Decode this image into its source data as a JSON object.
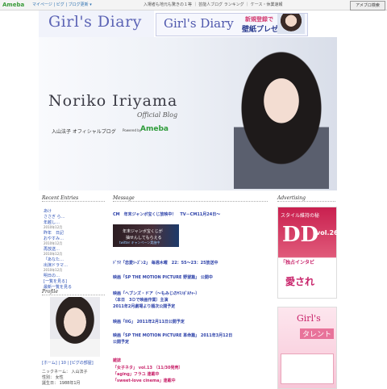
{
  "topbar": {
    "logo": "Ameba",
    "links": "マイページ | ピグ | ブログ更新 ▾",
    "news": "入場者も地元も驚きの１等 ｜ 芸能人ブログ ランキング ｜ ケース・休業速報",
    "search_button": "アメブロ検索"
  },
  "header": {
    "title": "Girl's Diary",
    "banner_title": "Girl's Diary",
    "banner_line1": "新規登録で",
    "banner_line2": "壁紙プレゼント!"
  },
  "hero": {
    "name": "Noriko Iriyama",
    "sub": "Official Blog",
    "jp": "入山法子 オフィシャルブログ",
    "powered": "Powered by",
    "ameba": "Ameba"
  },
  "sidebar": {
    "recent_head": "Recent Entries",
    "entries": [
      {
        "title": "あけ",
        "date": ""
      },
      {
        "title": "ささぎ ら…",
        "date": ""
      },
      {
        "title": "年越し…",
        "date": ""
      },
      {
        "title": "",
        "date": "2010年12月"
      },
      {
        "title": "昨年　日記",
        "date": ""
      },
      {
        "title": "おやすみ…",
        "date": "2010年12月"
      },
      {
        "title": "再放送…",
        "date": "2010年12月"
      },
      {
        "title": "「あなた…",
        "date": ""
      },
      {
        "title": "出演ドラマ…",
        "date": "2010年12月"
      },
      {
        "title": "明日の…",
        "date": ""
      },
      {
        "title": "[一覧を見る]",
        "date": ""
      },
      {
        "title": "最新一覧を見る",
        "date": ""
      }
    ],
    "profile_head": "Profile",
    "profile_links": "[ホーム] | 10 | [ピグの部屋]",
    "profile_name": "ニックネーム： 入山法子",
    "profile_gender": "性別： 女性",
    "profile_birth": "誕生日： 1988年1月"
  },
  "main": {
    "head": "Message",
    "items": [
      {
        "text": "CM　年末ジャンボ宝くじ放映中！　TV－CM11月24日～",
        "red": false
      },
      {
        "text": "ﾄﾞﾗﾏ「恋愛ｼｰｽﾞﾝ2」 毎週木曜　22：55～23：25放送中",
        "red": false
      },
      {
        "text": "映画「SP THE MOTION PICTURE 野望篇」 公開中",
        "red": false
      },
      {
        "text": "映画「ヘブンズ・ドア（～もみじのﾔﾏﾉﾎﾞﾙﾁｬｰ）",
        "red": false
      },
      {
        "text": "（本日　3Ｄで映画作業）主演",
        "red": false
      },
      {
        "text": "2011年2月劇場より順次公開予定",
        "red": false
      },
      {
        "text": "映画「IIG」 2011年2月11日公開予定",
        "red": false
      },
      {
        "text": "映画「SP THE MOTION PICTURE 革命篇」 2011年3月12日",
        "red": false
      },
      {
        "text": "公開予定",
        "red": false
      },
      {
        "text": "雑誌",
        "red": true
      },
      {
        "text": "「女子ネタ」 vol.13 （11/30発売）",
        "red": true
      },
      {
        "text": "「aging」フラユ 連載中",
        "red": true
      },
      {
        "text": "「sweet-love cinema」連載中",
        "red": true
      }
    ],
    "image_text1": "年末ジャンボ宝くじが",
    "image_text2": "抽せんしてもらえる",
    "image_text3": "twitter キャンペーン実施中"
  },
  "ads": {
    "head": "Advertising",
    "ad1_top": "スタイル維持の秘",
    "ad1_dd": "DD",
    "ad1_vol": "vol.26",
    "ad1_jp": "「独占インタビ",
    "ad1_big": "愛され",
    "ad2_title": "Girl's",
    "ad2_sub": "タレント"
  }
}
